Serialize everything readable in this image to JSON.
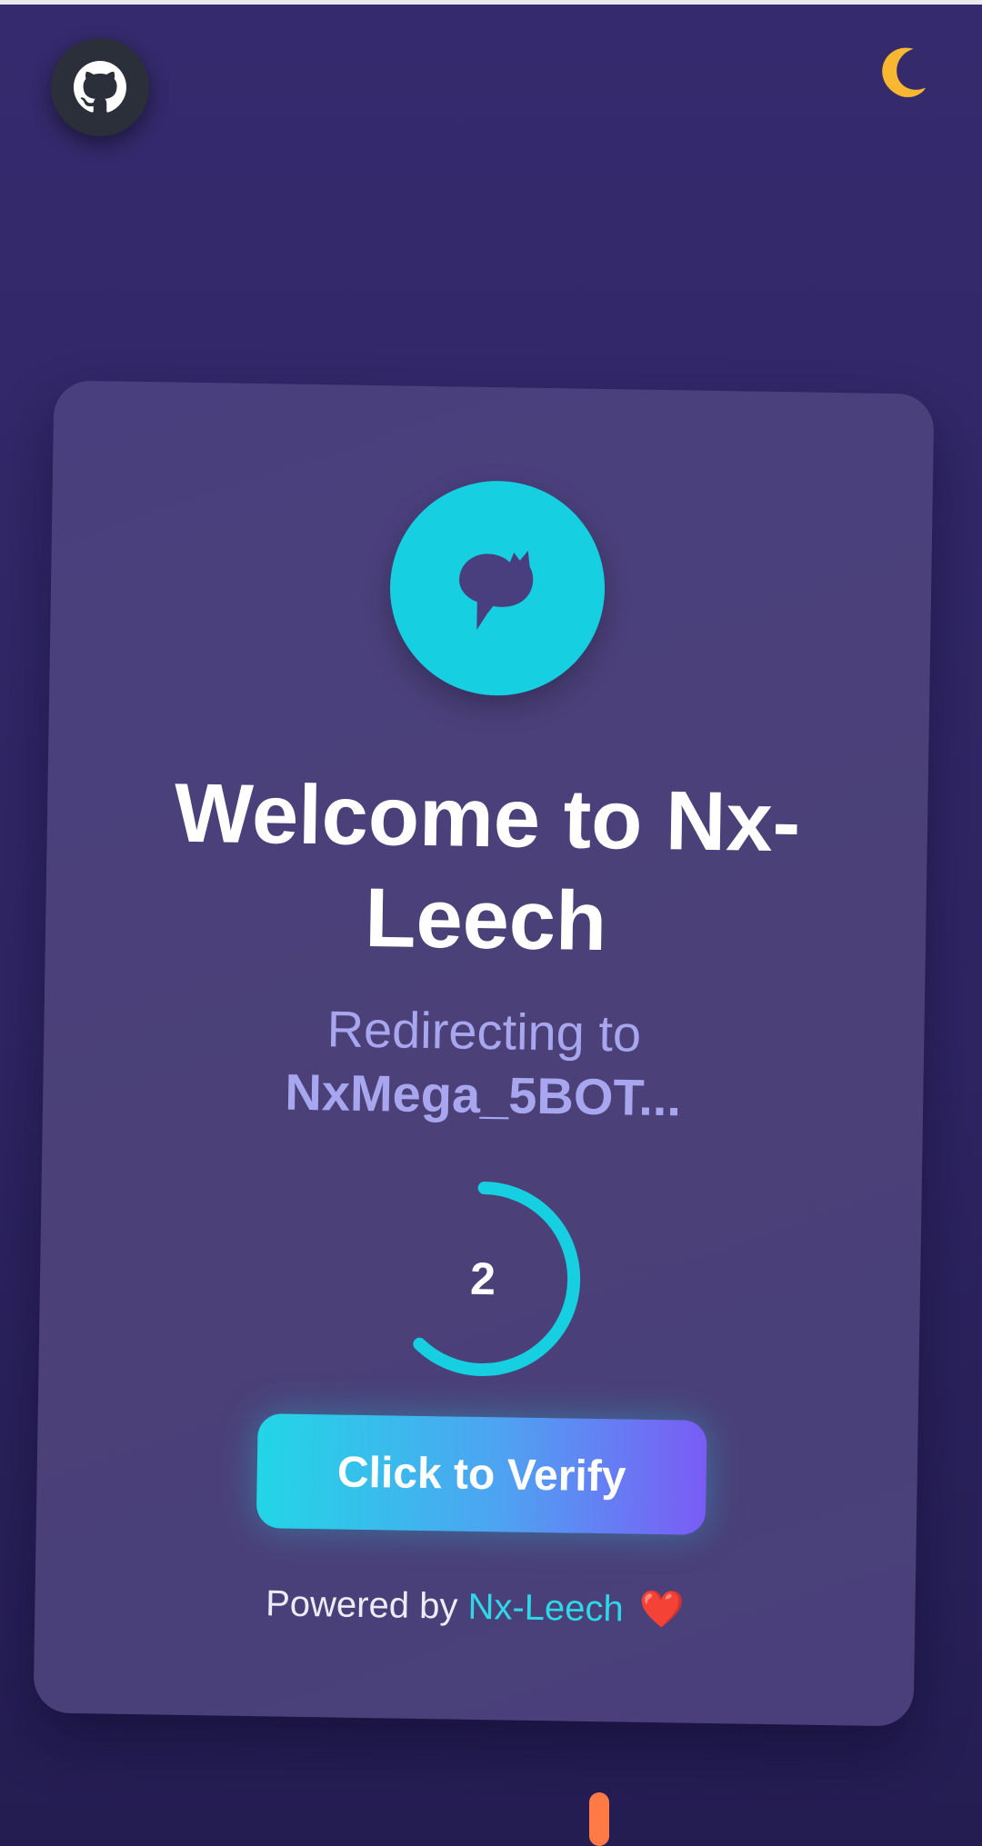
{
  "header": {
    "github_icon": "github-icon",
    "theme_icon": "crescent-moon-icon"
  },
  "card": {
    "logo_icon": "leech-logo-icon",
    "title_line1": "Welcome to Nx-",
    "title_line2": "Leech",
    "redirect_text": "Redirecting to",
    "bot_name": "NxMega_5BOT...",
    "countdown": "2",
    "countdown_progress": 0.62,
    "verify_label": "Click to Verify",
    "powered_by": "Powered by",
    "powered_link": "Nx-Leech",
    "heart": "❤️"
  },
  "colors": {
    "accent": "#16cfe0",
    "button_start": "#22d6e6",
    "button_end": "#7a5cf5",
    "moon": "#f7b731",
    "scroll_handle": "#ff7a45"
  }
}
